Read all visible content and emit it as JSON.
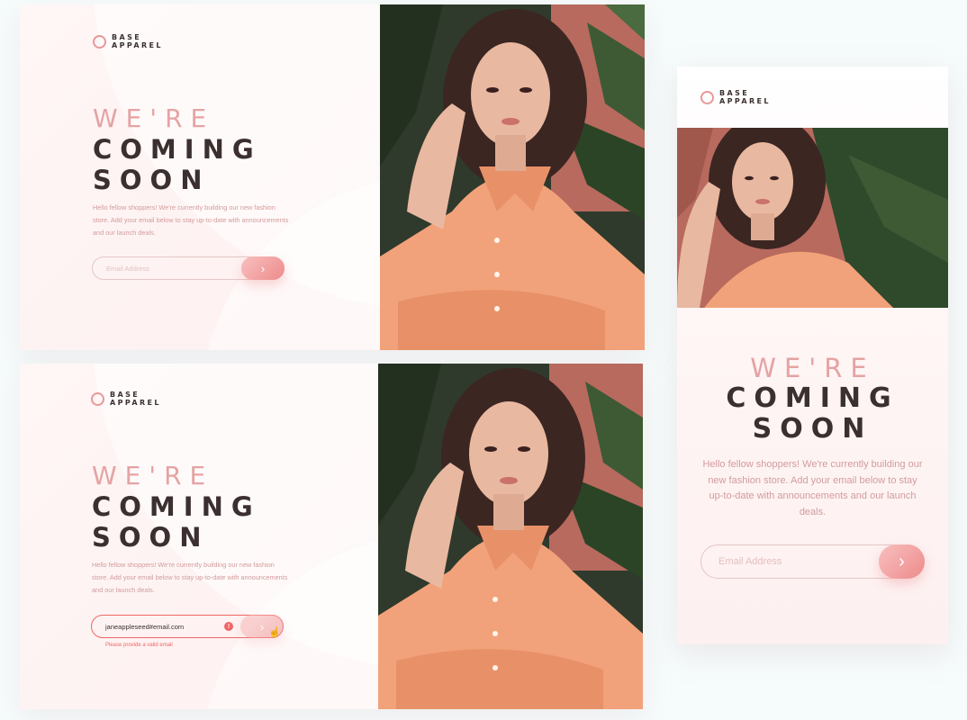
{
  "brand": {
    "logo_text": "BASE\nAPPAREL"
  },
  "hero": {
    "headline_light": "WE'RE",
    "headline_dark_1": "COMING",
    "headline_dark_2": "SOON",
    "description": "Hello fellow shoppers! We're currently building our new fashion store. Add your email below to stay up-to-date with announcements and our launch deals."
  },
  "form": {
    "placeholder": "Email Address",
    "filled_value": "janeappleseed#email.com",
    "submit_icon": "chevron-right-icon",
    "submit_glyph": "›",
    "error_glyph": "!",
    "error_message": "Please provide a valid email"
  },
  "colors": {
    "accent": "#e89898",
    "dark_text": "#3b2f2f",
    "muted_text": "#d39b9b",
    "error": "#f06565",
    "shirt": "#f2a27a",
    "background": "#f6fbfb"
  }
}
